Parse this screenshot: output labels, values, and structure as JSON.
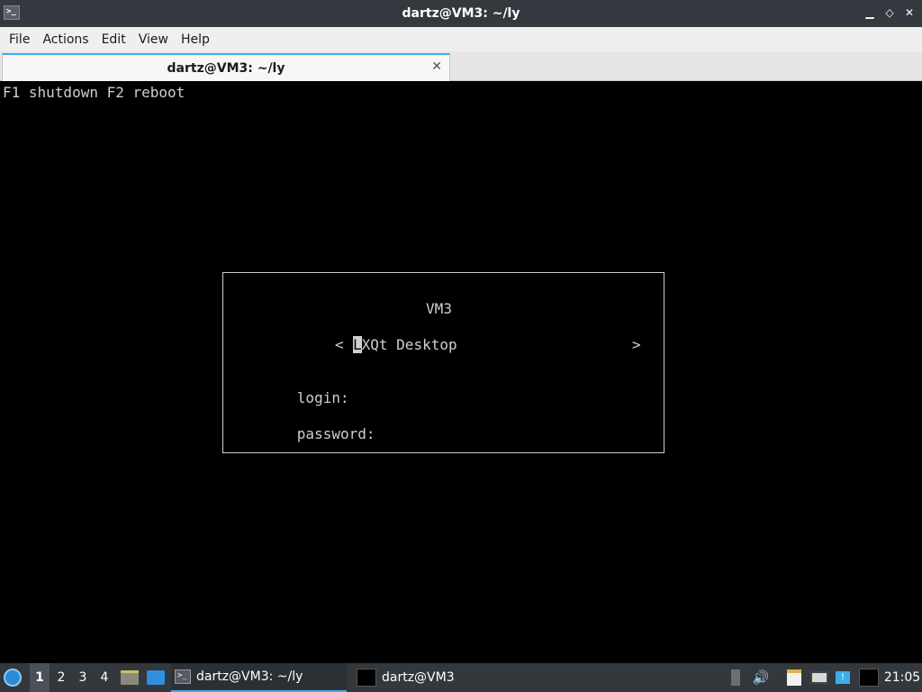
{
  "window": {
    "title": "dartz@VM3: ~/ly",
    "app_icon": "terminal-icon",
    "controls": {
      "minimize": "▁",
      "restore": "◇",
      "close": "✕"
    }
  },
  "menubar": {
    "items": [
      {
        "label": "File"
      },
      {
        "label": "Actions"
      },
      {
        "label": "Edit"
      },
      {
        "label": "View"
      },
      {
        "label": "Help"
      }
    ]
  },
  "tabs": [
    {
      "label": "dartz@VM3: ~/ly",
      "close": "✕",
      "active": true
    }
  ],
  "terminal": {
    "hint": "F1 shutdown F2 reboot",
    "login_box": {
      "hostname": "VM3",
      "arrow_left": "<",
      "arrow_right": ">",
      "session_first_char": "L",
      "session_rest": "XQt Desktop",
      "login_label": "login:",
      "password_label": "password:"
    }
  },
  "taskbar": {
    "desktops": [
      "1",
      "2",
      "3",
      "4"
    ],
    "active_desktop": "1",
    "tasks": [
      {
        "label": "dartz@VM3: ~/ly",
        "icon": "terminal-icon",
        "active": true
      },
      {
        "label": "dartz@VM3",
        "icon": "vm-window-icon",
        "active": false
      }
    ],
    "clock": "21:05"
  },
  "colors": {
    "titlebar_bg": "#34393f",
    "accent": "#3daee9",
    "terminal_fg": "#cfcfcf",
    "terminal_bg": "#000000",
    "taskbar_bg": "#33383d"
  }
}
